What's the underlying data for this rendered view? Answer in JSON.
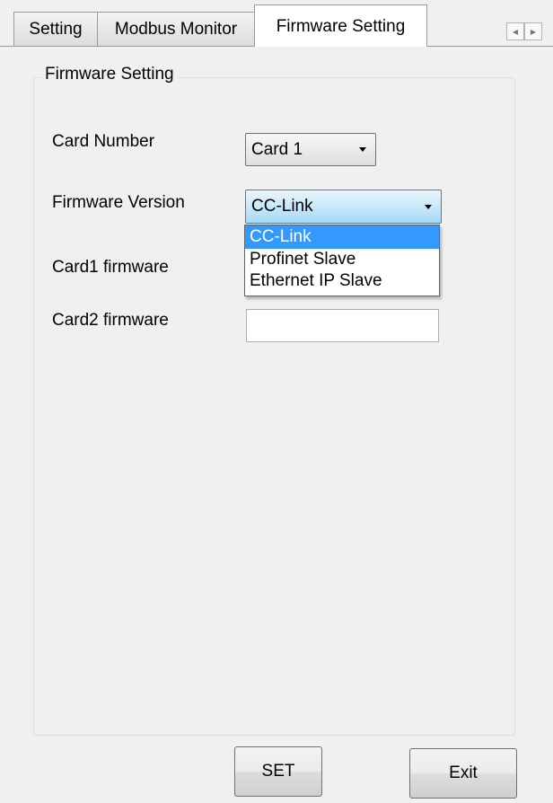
{
  "tabs": [
    {
      "label": "Setting"
    },
    {
      "label": "Modbus Monitor"
    },
    {
      "label": "Firmware Setting",
      "active": true
    }
  ],
  "group": {
    "title": "Firmware Setting"
  },
  "fields": {
    "card_number": {
      "label": "Card Number",
      "value": "Card 1"
    },
    "firmware_version": {
      "label": "Firmware Version",
      "value": "CC-Link",
      "options": [
        "CC-Link",
        "Profinet Slave",
        "Ethernet IP Slave"
      ],
      "highlighted_option": "CC-Link"
    },
    "card1_firmware": {
      "label": "Card1 firmware",
      "value": ""
    },
    "card2_firmware": {
      "label": "Card2 firmware",
      "value": ""
    }
  },
  "buttons": {
    "set": "SET",
    "exit": "Exit"
  },
  "icons": {
    "scroll_left": "chevron-left-icon",
    "scroll_right": "chevron-right-icon"
  },
  "colors": {
    "selection": "#3399ff",
    "background": "#f0f0f0"
  }
}
